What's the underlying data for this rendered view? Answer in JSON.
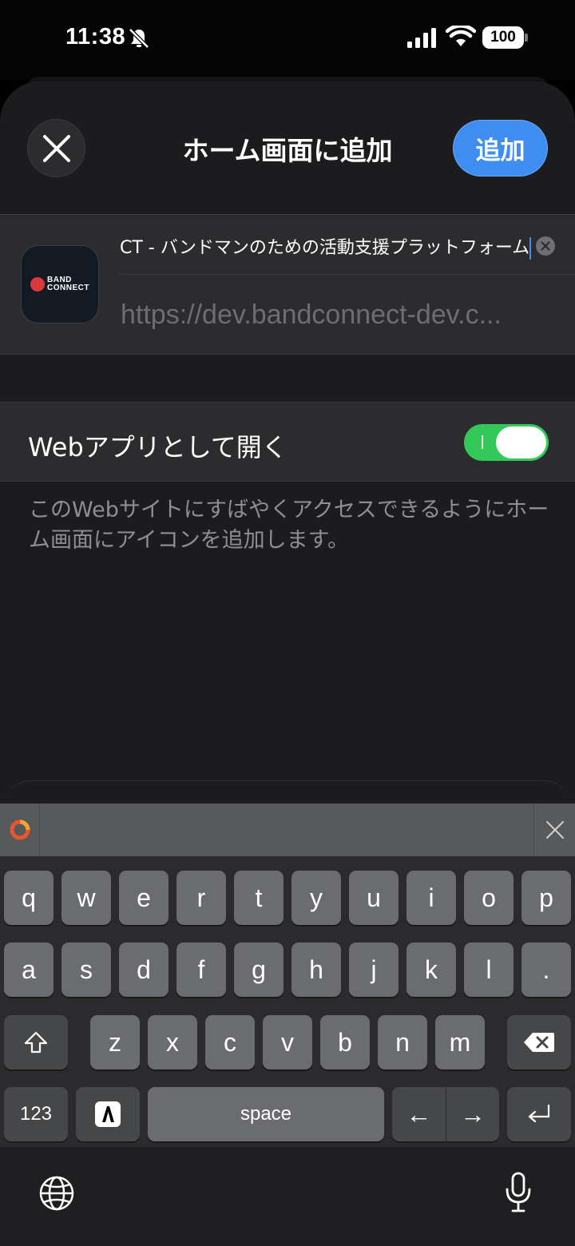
{
  "status_bar": {
    "time": "11:38",
    "battery": "100"
  },
  "header": {
    "title": "ホーム画面に追加",
    "add_label": "追加"
  },
  "app_info": {
    "icon_line1": "BAND",
    "icon_line2": "CONNECT",
    "name_value": "CT - バンドマンのための活動支援プラットフォーム",
    "url": "https://dev.bandconnect-dev.c..."
  },
  "web_app_toggle": {
    "label": "Webアプリとして開く",
    "state": "on"
  },
  "footnote": "このWebサイトにすばやくアクセスできるようにホーム画面にアイコンを追加します。",
  "keyboard": {
    "row1": [
      "q",
      "w",
      "e",
      "r",
      "t",
      "y",
      "u",
      "i",
      "o",
      "p"
    ],
    "row2": [
      "a",
      "s",
      "d",
      "f",
      "g",
      "h",
      "j",
      "k",
      "l",
      "."
    ],
    "row3": [
      "z",
      "x",
      "c",
      "v",
      "b",
      "n",
      "m"
    ],
    "numbers_key": "123",
    "space_key": "space",
    "left_arrow": "←",
    "right_arrow": "→"
  },
  "icons": [
    "bell-slash-icon",
    "cellular-signal-icon",
    "wifi-icon",
    "close-icon",
    "clear-text-icon",
    "shift-icon",
    "delete-icon",
    "globe-icon",
    "microphone-icon",
    "return-icon"
  ]
}
